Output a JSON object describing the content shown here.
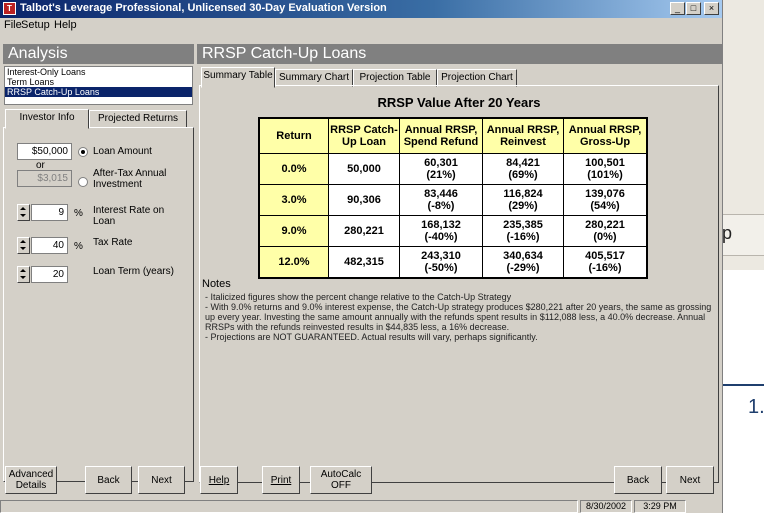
{
  "window": {
    "title": "Talbot's Leverage Professional, Unlicensed 30-Day Evaluation Version",
    "app_icon_text": "T",
    "controls": [
      "_",
      "□",
      "×"
    ]
  },
  "menu": {
    "file": "File",
    "setup": "Setup",
    "help": "Help"
  },
  "left": {
    "header": "Analysis",
    "loan_types": [
      "Interest-Only Loans",
      "Term Loans",
      "RRSP Catch-Up Loans"
    ],
    "tabs": [
      "Investor Info",
      "Projected Returns"
    ],
    "loan_amount_value": "$50,000",
    "loan_amount_label": "Loan Amount",
    "or_label": "or",
    "after_tax_value": "$3,015",
    "after_tax_label": "After-Tax Annual Investment",
    "interest_rate_value": "9",
    "interest_rate_unit": "%",
    "interest_rate_label": "Interest Rate on Loan",
    "tax_rate_value": "40",
    "tax_rate_unit": "%",
    "tax_rate_label": "Tax Rate",
    "loan_term_value": "20",
    "loan_term_label": "Loan Term (years)",
    "buttons": {
      "advanced": "Advanced Details",
      "back": "Back",
      "next": "Next"
    }
  },
  "right": {
    "header": "RRSP Catch-Up Loans",
    "tabs": [
      "Summary Table",
      "Summary Chart",
      "Projection Table",
      "Projection Chart"
    ],
    "table_title": "RRSP Value After 20 Years",
    "columns": [
      "Return",
      "RRSP Catch-Up Loan",
      "Annual RRSP, Spend Refund",
      "Annual RRSP, Reinvest",
      "Annual RRSP, Gross-Up"
    ],
    "rows": [
      {
        "ret": "0.0%",
        "loan": "50,000",
        "spend": "60,301",
        "spend_pct": "(21%)",
        "reinvest": "84,421",
        "reinvest_pct": "(69%)",
        "gross": "100,501",
        "gross_pct": "(101%)"
      },
      {
        "ret": "3.0%",
        "loan": "90,306",
        "spend": "83,446",
        "spend_pct": "(-8%)",
        "reinvest": "116,824",
        "reinvest_pct": "(29%)",
        "gross": "139,076",
        "gross_pct": "(54%)"
      },
      {
        "ret": "9.0%",
        "loan": "280,221",
        "spend": "168,132",
        "spend_pct": "(-40%)",
        "reinvest": "235,385",
        "reinvest_pct": "(-16%)",
        "gross": "280,221",
        "gross_pct": "(0%)"
      },
      {
        "ret": "12.0%",
        "loan": "482,315",
        "spend": "243,310",
        "spend_pct": "(-50%)",
        "reinvest": "340,634",
        "reinvest_pct": "(-29%)",
        "gross": "405,517",
        "gross_pct": "(-16%)"
      }
    ],
    "notes_header": "Notes",
    "notes": [
      "- Italicized figures show the percent change relative to the Catch-Up Strategy",
      "- With 9.0% returns and 9.0% interest expense, the Catch-Up strategy produces $280,221 after 20 years, the same as grossing up every year. Investing the same amount annually with the refunds spent results in $112,088 less, a 40.0% decrease. Annual RRSPs with the refunds reinvested results in $44,835 less, a 16% decrease.",
      "- Projections are NOT GUARANTEED. Actual results will vary, perhaps significantly."
    ],
    "buttons": {
      "help": "Help",
      "print": "Print",
      "autocalc": "AutoCalc OFF",
      "back": "Back",
      "next": "Next"
    }
  },
  "status": {
    "date": "8/30/2002",
    "time": "3:29 PM"
  },
  "background": {
    "fragment": "p",
    "number": "1."
  }
}
